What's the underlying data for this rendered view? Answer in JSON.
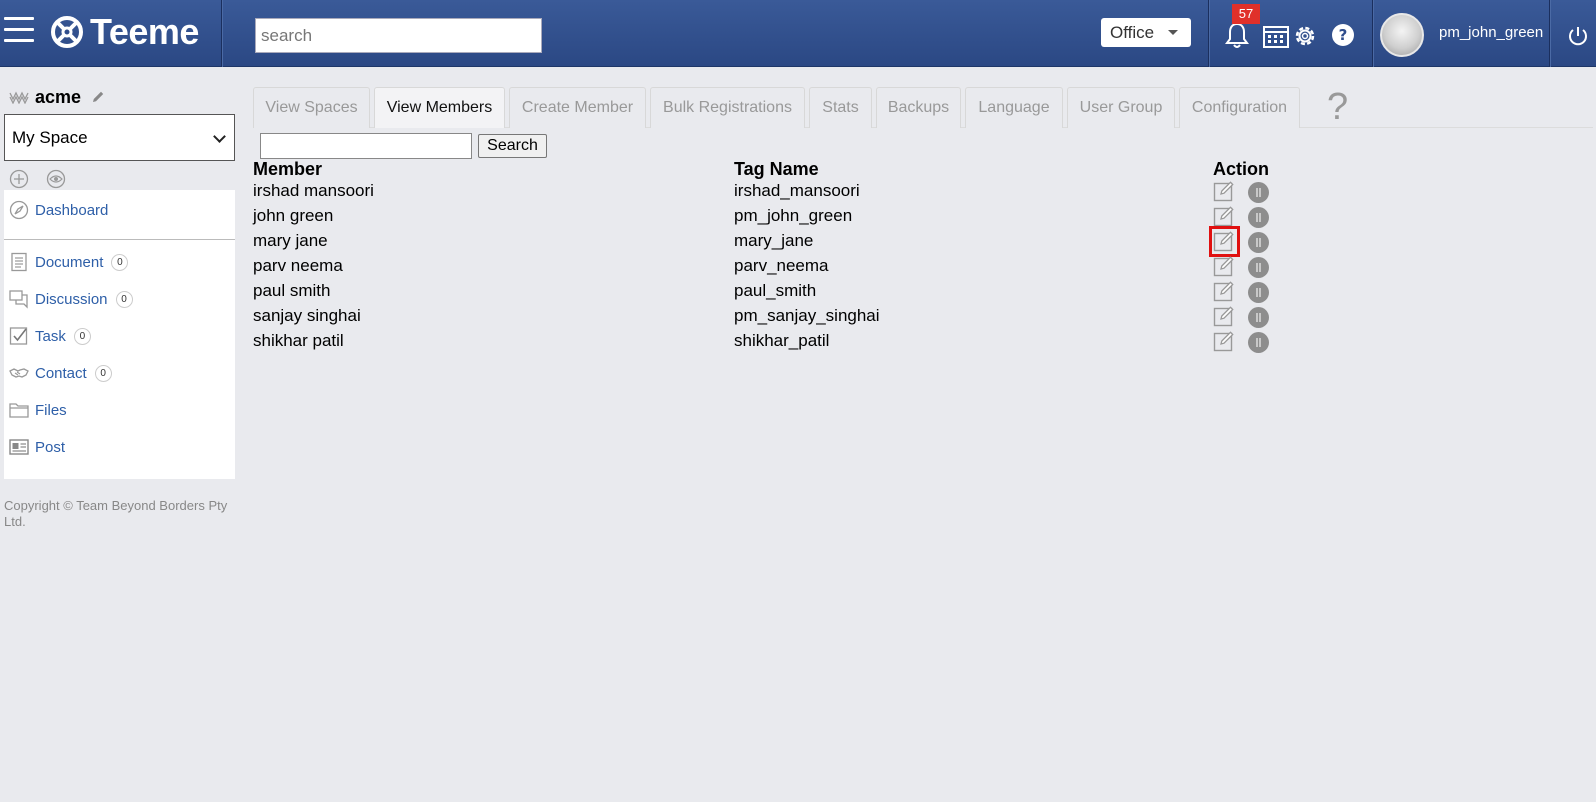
{
  "header": {
    "logo_text": "Teeme",
    "search_placeholder": "search",
    "office_label": "Office",
    "notification_count": "57",
    "username": "pm_john_green"
  },
  "sidebar": {
    "space_name": "acme",
    "space_select": "My Space",
    "items": [
      {
        "label": "Dashboard",
        "icon": "dashboard-icon"
      },
      {
        "label": "Document",
        "count": "0",
        "icon": "document-icon"
      },
      {
        "label": "Discussion",
        "count": "0",
        "icon": "discussion-icon"
      },
      {
        "label": "Task",
        "count": "0",
        "icon": "task-icon"
      },
      {
        "label": "Contact",
        "count": "0",
        "icon": "contact-icon"
      },
      {
        "label": "Files",
        "icon": "folder-icon"
      },
      {
        "label": "Post",
        "icon": "post-icon"
      }
    ],
    "copyright": "Copyright © Team Beyond Borders Pty Ltd."
  },
  "tabs": [
    {
      "label": "View Spaces",
      "active": false
    },
    {
      "label": "View Members",
      "active": true
    },
    {
      "label": "Create Member",
      "active": false
    },
    {
      "label": "Bulk Registrations",
      "active": false
    },
    {
      "label": "Stats",
      "active": false
    },
    {
      "label": "Backups",
      "active": false
    },
    {
      "label": "Language",
      "active": false
    },
    {
      "label": "User Group",
      "active": false
    },
    {
      "label": "Configuration",
      "active": false
    }
  ],
  "help_mark": "?",
  "members": {
    "search_value": "",
    "search_button": "Search",
    "columns": [
      "Member",
      "Tag Name",
      "Action"
    ],
    "rows": [
      {
        "member": "irshad mansoori",
        "tag": "irshad_mansoori"
      },
      {
        "member": "john green",
        "tag": "pm_john_green"
      },
      {
        "member": "mary jane",
        "tag": "mary_jane",
        "highlighted": true
      },
      {
        "member": "parv neema",
        "tag": "parv_neema"
      },
      {
        "member": "paul smith",
        "tag": "paul_smith"
      },
      {
        "member": "sanjay singhai",
        "tag": "pm_sanjay_singhai"
      },
      {
        "member": "shikhar patil",
        "tag": "shikhar_patil"
      }
    ]
  },
  "colors": {
    "header": "#2f4d8c",
    "link": "#2e5fa8",
    "badge": "#e0302a",
    "highlight": "#e01010"
  }
}
